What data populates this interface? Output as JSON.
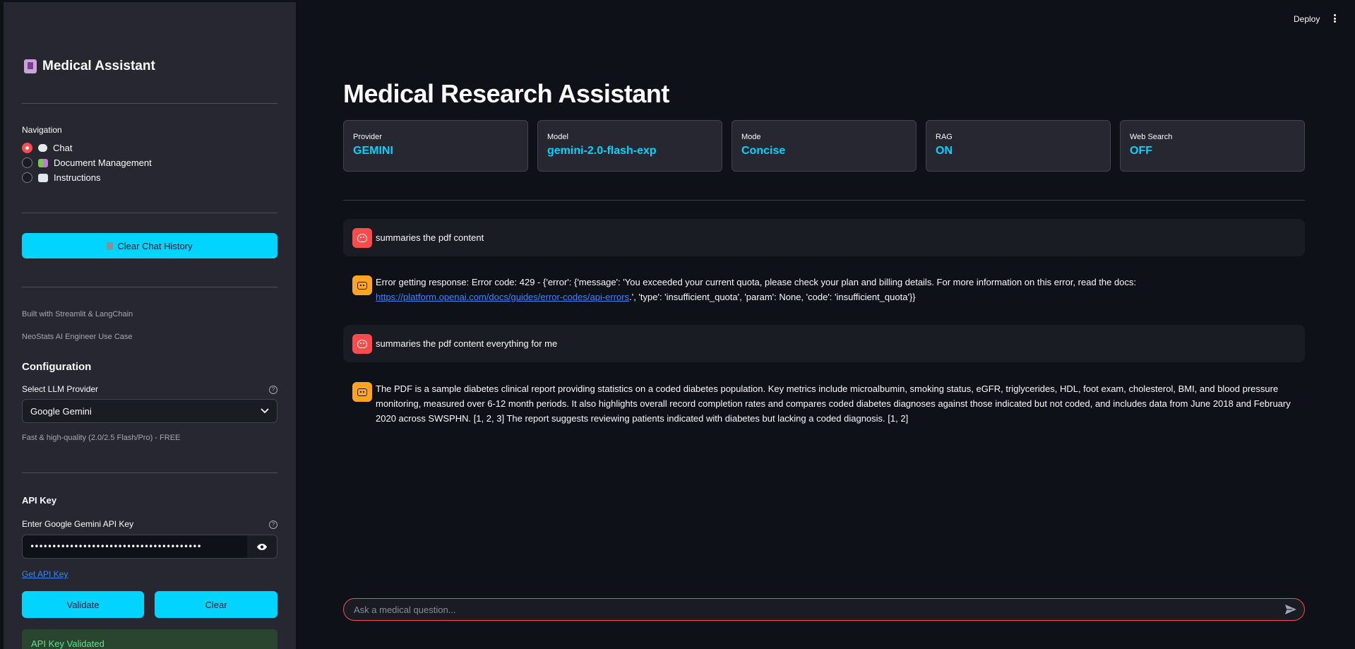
{
  "sidebar": {
    "app_title": "Medical Assistant",
    "navigation_label": "Navigation",
    "nav_options": [
      {
        "label": "Chat",
        "selected": true
      },
      {
        "label": "Document Management",
        "selected": false
      },
      {
        "label": "Instructions",
        "selected": false
      }
    ],
    "clear_history_label": "Clear Chat History",
    "footer_built": "Built with Streamlit & LangChain",
    "footer_usecase": "NeoStats AI Engineer Use Case",
    "configuration_heading": "Configuration",
    "provider_label": "Select LLM Provider",
    "provider_selected": "Google Gemini",
    "provider_caption": "Fast & high-quality (2.0/2.5 Flash/Pro) - FREE",
    "api_key_heading": "API Key",
    "api_key_label": "Enter Google Gemini API Key",
    "api_key_value": "•••••••••••••••••••••••••••••••••••••••",
    "get_api_key_label": "Get API Key",
    "validate_label": "Validate",
    "clear_label": "Clear",
    "validated_message": "API Key Validated"
  },
  "header": {
    "deploy_label": "Deploy"
  },
  "main": {
    "title": "Medical Research Assistant",
    "metrics": [
      {
        "label": "Provider",
        "value": "GEMINI"
      },
      {
        "label": "Model",
        "value": "gemini-2.0-flash-exp"
      },
      {
        "label": "Mode",
        "value": "Concise"
      },
      {
        "label": "RAG",
        "value": "ON"
      },
      {
        "label": "Web Search",
        "value": "OFF"
      }
    ],
    "messages": [
      {
        "role": "user",
        "text": "summaries the pdf content"
      },
      {
        "role": "assistant",
        "text_before_link": "Error getting response: Error code: 429 - {'error': {'message': 'You exceeded your current quota, please check your plan and billing details. For more information on this error, read the docs: ",
        "link": "https://platform.openai.com/docs/guides/error-codes/api-errors",
        "text_after_link": ".', 'type': 'insufficient_quota', 'param': None, 'code': 'insufficient_quota'}}"
      },
      {
        "role": "user",
        "text": "summaries the pdf content everything for me"
      },
      {
        "role": "assistant",
        "text": "The PDF is a sample diabetes clinical report providing statistics on a coded diabetes population. Key metrics include microalbumin, smoking status, eGFR, triglycerides, HDL, foot exam, cholesterol, BMI, and blood pressure monitoring, measured over 6-12 month periods. It also highlights overall record completion rates and compares coded diabetes diagnoses against those indicated but not coded, and includes data from June 2018 and February 2020 across SWSPHN. [1, 2, 3] The report suggests reviewing patients indicated with diabetes but lacking a coded diagnosis. [1, 2]"
      }
    ],
    "chat_placeholder": "Ask a medical question..."
  },
  "colors": {
    "accent": "#00d4ff",
    "user_avatar": "#ff4b4b",
    "bot_avatar": "#ffa421",
    "success_text": "#5ce488"
  }
}
